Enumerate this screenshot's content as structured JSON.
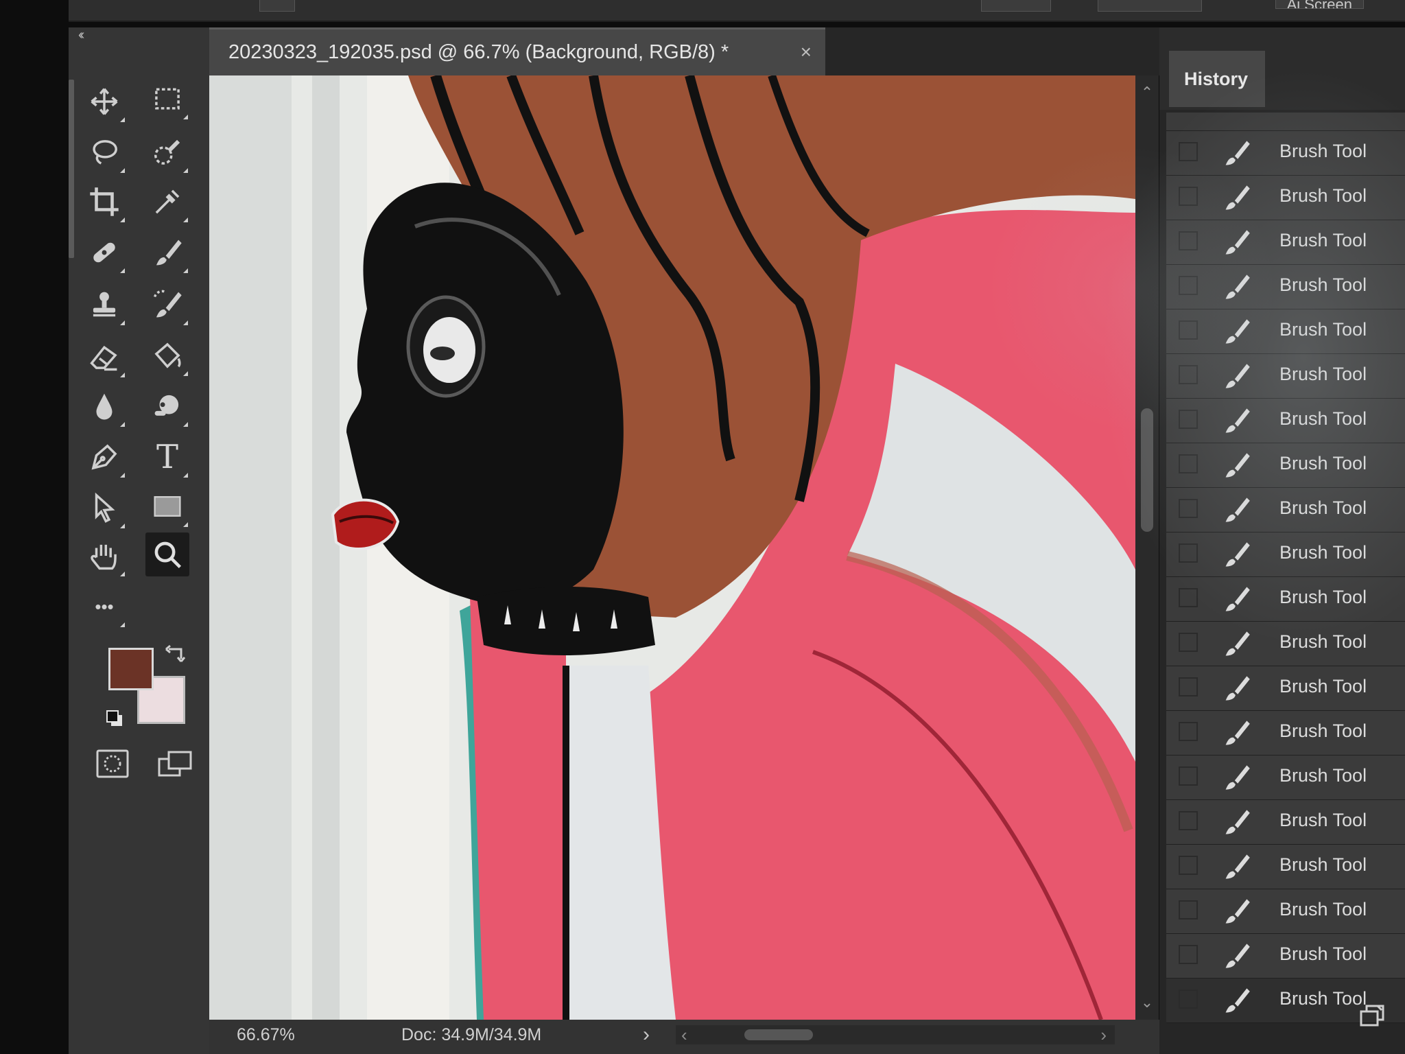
{
  "app": {
    "document_tab": {
      "title": "20230323_192035.psd @ 66.7% (Background, RGB/8) *",
      "close_glyph": "×"
    },
    "top_right_label": "Ai Screen"
  },
  "toolbar": {
    "collapse_glyph": "‹‹",
    "tools": [
      {
        "icon": "move-icon"
      },
      {
        "icon": "rectangular-marquee-icon"
      },
      {
        "icon": "lasso-icon"
      },
      {
        "icon": "quick-selection-icon"
      },
      {
        "icon": "crop-icon"
      },
      {
        "icon": "eyedropper-icon"
      },
      {
        "icon": "spot-healing-icon"
      },
      {
        "icon": "brush-icon"
      },
      {
        "icon": "clone-stamp-icon"
      },
      {
        "icon": "history-brush-icon"
      },
      {
        "icon": "eraser-icon"
      },
      {
        "icon": "paint-bucket-icon"
      },
      {
        "icon": "blur-icon"
      },
      {
        "icon": "dodge-icon"
      },
      {
        "icon": "pen-icon"
      },
      {
        "icon": "type-icon"
      },
      {
        "icon": "path-selection-icon"
      },
      {
        "icon": "rectangle-icon"
      },
      {
        "icon": "hand-icon"
      },
      {
        "icon": "zoom-icon"
      },
      {
        "icon": "more-tools-icon"
      }
    ],
    "type_glyph": "T",
    "more_glyph": "•••",
    "foreground_color": "#6b3326",
    "background_color": "#ecdde0",
    "active_tool": "zoom"
  },
  "history": {
    "tab_label": "History",
    "items": [
      "Brush Tool",
      "Brush Tool",
      "Brush Tool",
      "Brush Tool",
      "Brush Tool",
      "Brush Tool",
      "Brush Tool",
      "Brush Tool",
      "Brush Tool",
      "Brush Tool",
      "Brush Tool",
      "Brush Tool",
      "Brush Tool",
      "Brush Tool",
      "Brush Tool",
      "Brush Tool",
      "Brush Tool",
      "Brush Tool",
      "Brush Tool",
      "Brush Tool"
    ]
  },
  "status": {
    "zoom": "66.67%",
    "doc_size": "Doc: 34.9M/34.9M",
    "arrow": "›",
    "scroll_left": "‹",
    "scroll_right": "›"
  },
  "scrollbar": {
    "up": "⌃",
    "down": "⌄"
  },
  "artwork": {
    "colors": {
      "pink": "#e8576e",
      "brown": "#9b5236",
      "black": "#111111",
      "white_wash": "#dfe3e2",
      "teal": "#3fa59a",
      "lips": "#b01c1c"
    }
  }
}
